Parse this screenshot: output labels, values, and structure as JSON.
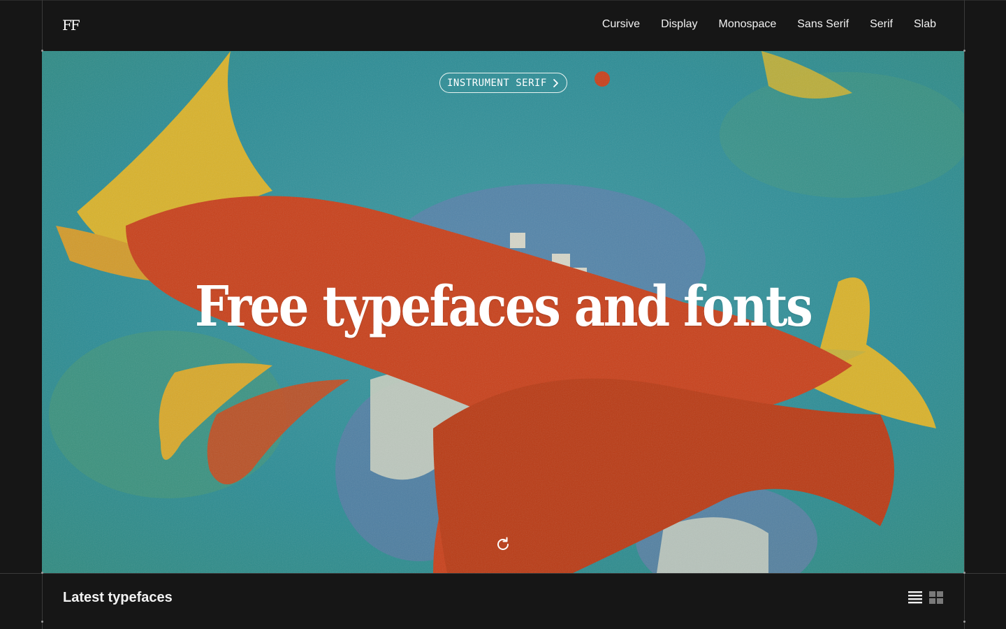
{
  "header": {
    "logo": "FF",
    "nav": [
      "Cursive",
      "Display",
      "Monospace",
      "Sans Serif",
      "Serif",
      "Slab"
    ]
  },
  "hero": {
    "tag": "INSTRUMENT SERIF",
    "title": "Free typefaces and fonts"
  },
  "section": {
    "title": "Latest typefaces"
  },
  "colors": {
    "background": "#161616",
    "teal": "#2a8f99",
    "orange": "#c8401a",
    "yellow": "#e0b12a"
  }
}
